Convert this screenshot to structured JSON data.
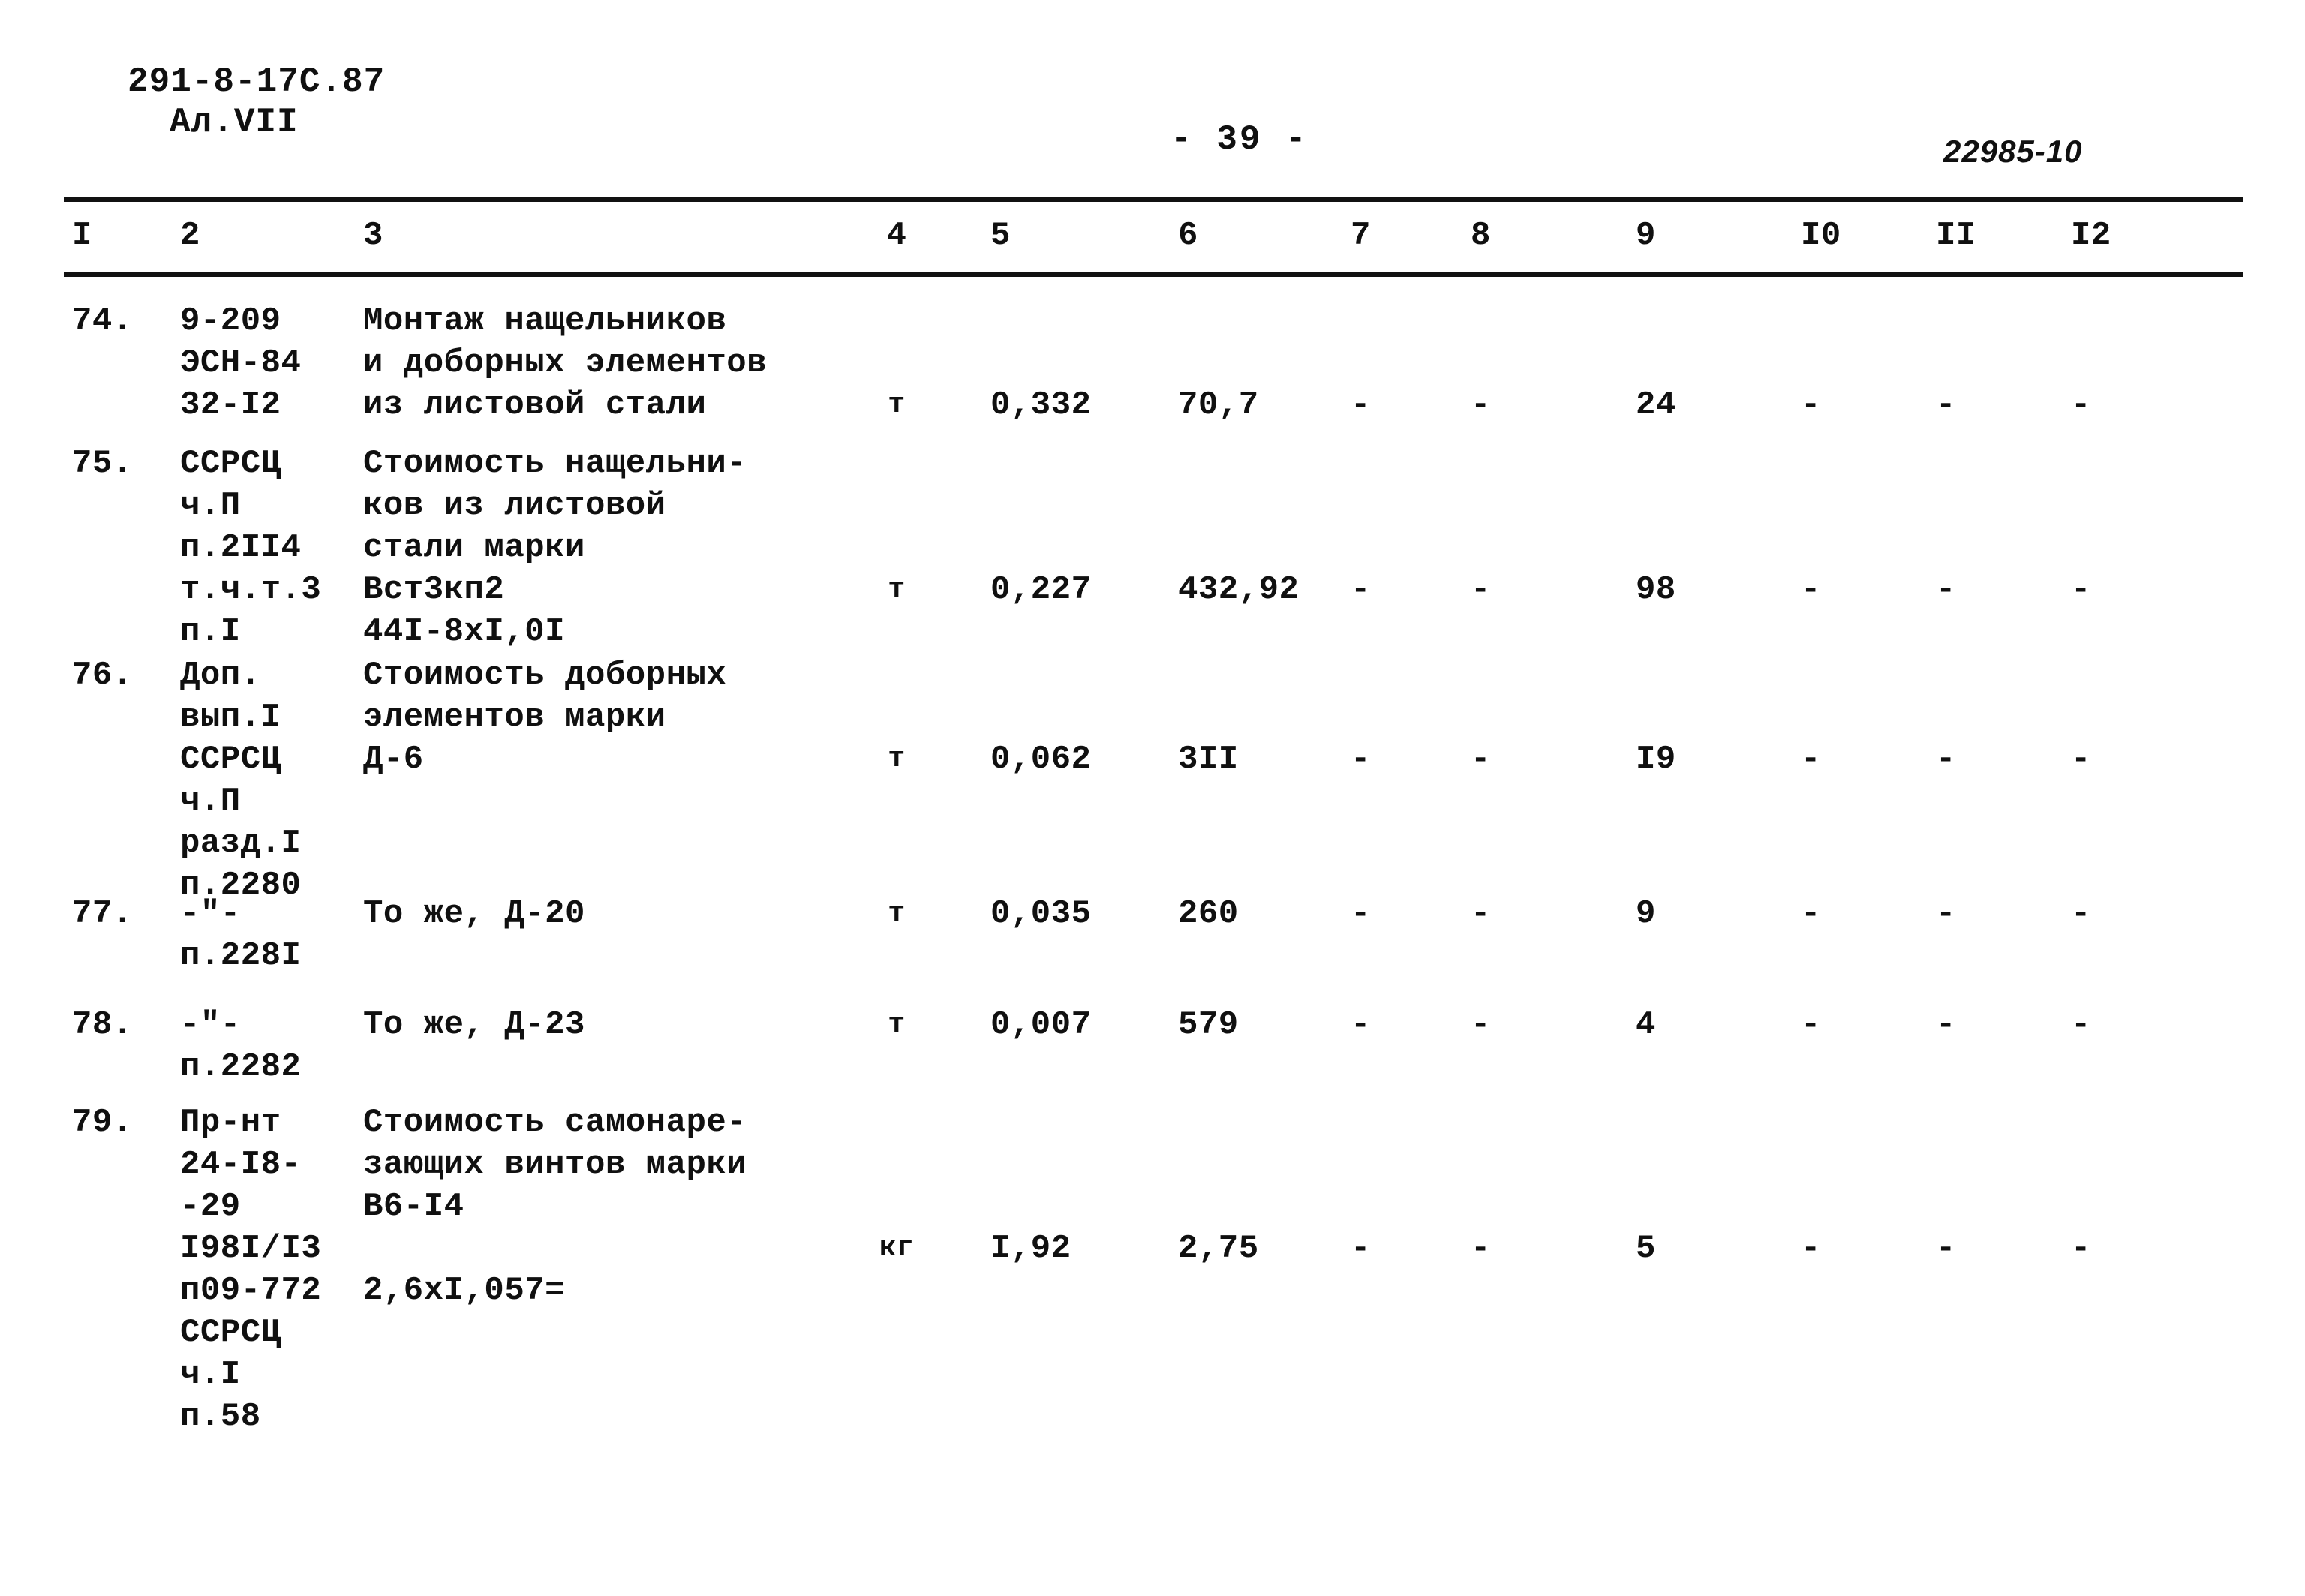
{
  "header": {
    "doc_code": "291-8-17С.87",
    "album": "Ал.VII",
    "page_number": "- 39 -",
    "archive_stamp": "22985-10"
  },
  "table": {
    "column_headers": [
      "I",
      "2",
      "3",
      "4",
      "5",
      "6",
      "7",
      "8",
      "9",
      "I0",
      "II",
      "I2"
    ],
    "rows": [
      {
        "num": "74.",
        "code_lines": [
          "9-209",
          "ЭСН-84",
          "32-I2"
        ],
        "description_lines": [
          "Монтаж нащельников",
          "и доборных элементов",
          "из листовой стали"
        ],
        "unit": "т",
        "c5": "0,332",
        "c6": "70,7",
        "c7": "-",
        "c8": "-",
        "c9": "24",
        "c10": "-",
        "c11": "-",
        "c12": "-"
      },
      {
        "num": "75.",
        "code_lines": [
          "ССРСЦ",
          "ч.П",
          "п.2II4",
          "т.ч.т.3",
          "п.I"
        ],
        "description_lines": [
          "Стоимость нащельни-",
          "ков из листовой",
          "стали марки",
          "Вст3кп2",
          "44I-8хI,0I"
        ],
        "unit": "т",
        "c5": "0,227",
        "c6": "432,92",
        "c7": "-",
        "c8": "-",
        "c9": "98",
        "c10": "-",
        "c11": "-",
        "c12": "-"
      },
      {
        "num": "76.",
        "code_lines": [
          "Доп.",
          "вып.I",
          "ССРСЦ",
          "ч.П",
          "разд.I",
          "п.2280"
        ],
        "description_lines": [
          "Стоимость доборных",
          "элементов марки",
          "Д-6"
        ],
        "unit": "т",
        "c5": "0,062",
        "c6": "3II",
        "c7": "-",
        "c8": "-",
        "c9": "I9",
        "c10": "-",
        "c11": "-",
        "c12": "-"
      },
      {
        "num": "77.",
        "code_lines": [
          "-\"-",
          "п.228I"
        ],
        "description_lines": [
          "То же, Д-20"
        ],
        "unit": "т",
        "c5": "0,035",
        "c6": "260",
        "c7": "-",
        "c8": "-",
        "c9": "9",
        "c10": "-",
        "c11": "-",
        "c12": "-"
      },
      {
        "num": "78.",
        "code_lines": [
          "-\"-",
          "п.2282"
        ],
        "description_lines": [
          "То же, Д-23"
        ],
        "unit": "т",
        "c5": "0,007",
        "c6": "579",
        "c7": "-",
        "c8": "-",
        "c9": "4",
        "c10": "-",
        "c11": "-",
        "c12": "-"
      },
      {
        "num": "79.",
        "code_lines": [
          "Пр-нт",
          "24-I8-",
          "-29",
          "I98I/I3",
          "п09-772",
          "ССРСЦ",
          "ч.I",
          "п.58"
        ],
        "description_lines": [
          "Стоимость самонаре-",
          "зающих винтов марки",
          "В6-I4",
          "",
          "2,6хI,057="
        ],
        "unit": "кг",
        "c5": "I,92",
        "c6": "2,75",
        "c7": "-",
        "c8": "-",
        "c9": "5",
        "c10": "-",
        "c11": "-",
        "c12": "-"
      }
    ]
  }
}
